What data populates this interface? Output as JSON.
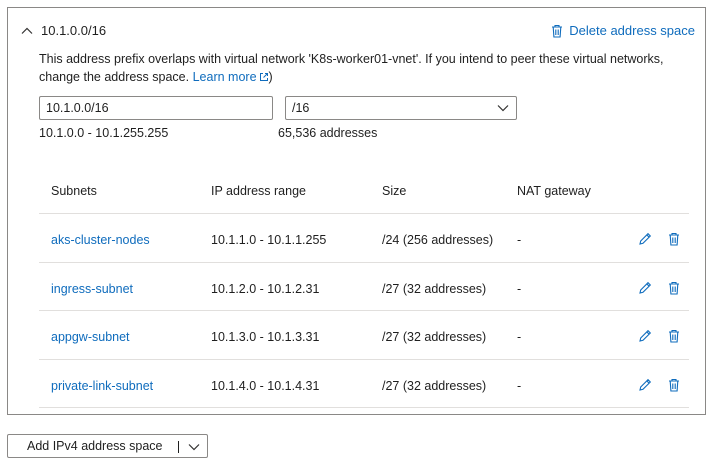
{
  "address_space": {
    "prefix_title": "10.1.0.0/16",
    "delete_label": "Delete address space",
    "warning_text": "This address prefix overlaps with virtual network 'K8s-worker01-vnet'. If you intend to peer these virtual networks, change the address space.",
    "learn_more_label": "Learn more",
    "warning_suffix": ")",
    "address_input_value": "10.1.0.0/16",
    "cidr_selected": "/16",
    "range_text": "10.1.0.0 - 10.1.255.255",
    "address_count": "65,536 addresses"
  },
  "subnets_table": {
    "headers": [
      "Subnets",
      "IP address range",
      "Size",
      "NAT gateway"
    ],
    "rows": [
      {
        "name": "aks-cluster-nodes",
        "range": "10.1.1.0 - 10.1.1.255",
        "size": "/24 (256 addresses)",
        "nat": "-"
      },
      {
        "name": "ingress-subnet",
        "range": "10.1.2.0 - 10.1.2.31",
        "size": "/27 (32 addresses)",
        "nat": "-"
      },
      {
        "name": "appgw-subnet",
        "range": "10.1.3.0 - 10.1.3.31",
        "size": "/27 (32 addresses)",
        "nat": "-"
      },
      {
        "name": "private-link-subnet",
        "range": "10.1.4.0 - 10.1.4.31",
        "size": "/27 (32 addresses)",
        "nat": "-"
      }
    ]
  },
  "footer": {
    "add_button_label": "Add IPv4 address space"
  },
  "icons": {
    "collapse": "chevron-up-icon",
    "delete": "trash-icon",
    "edit": "pencil-icon",
    "external": "external-link-icon",
    "dropdown": "chevron-down-icon"
  },
  "colors": {
    "link": "#0f6cbd",
    "border": "#8a8886",
    "row_divider": "#e1dfdd"
  }
}
